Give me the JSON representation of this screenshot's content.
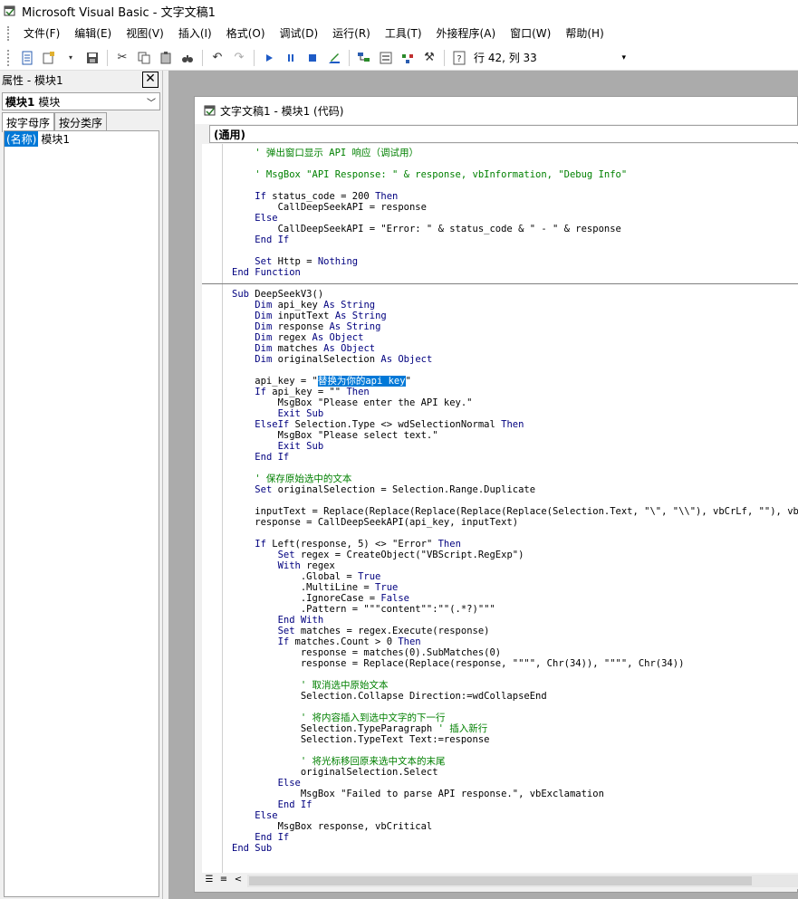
{
  "app": {
    "title": "Microsoft Visual Basic - 文字文稿1"
  },
  "menu": [
    "文件(F)",
    "编辑(E)",
    "视图(V)",
    "插入(I)",
    "格式(O)",
    "调试(D)",
    "运行(R)",
    "工具(T)",
    "外接程序(A)",
    "窗口(W)",
    "帮助(H)"
  ],
  "toolbar": {
    "status": "行 42, 列 33"
  },
  "properties": {
    "title": "属性 - 模块1",
    "object_name": "模块1",
    "object_type": "模块",
    "tabs": [
      "按字母序",
      "按分类序"
    ],
    "rows": [
      {
        "name": "(名称)",
        "value": "模块1"
      }
    ]
  },
  "code_window": {
    "title": "文字文稿1 - 模块1 (代码)",
    "object_combo": "(通用)",
    "selected_text": "替换为你的api key"
  },
  "code_lines": [
    {
      "t": "    ' 弹出窗口显示 API 响应（调试用）",
      "c": "cm"
    },
    {
      "t": "",
      "c": ""
    },
    {
      "t": "    ' MsgBox \"API Response: \" & response, vbInformation, \"Debug Info\"",
      "c": "cm"
    },
    {
      "t": "",
      "c": ""
    },
    {
      "t": "    If status_code = 200 Then",
      "c": ""
    },
    {
      "t": "        CallDeepSeekAPI = response",
      "c": ""
    },
    {
      "t": "    Else",
      "c": ""
    },
    {
      "t": "        CallDeepSeekAPI = \"Error: \" & status_code & \" - \" & response",
      "c": ""
    },
    {
      "t": "    End If",
      "c": ""
    },
    {
      "t": "",
      "c": ""
    },
    {
      "t": "    Set Http = Nothing",
      "c": ""
    },
    {
      "t": "End Function",
      "c": ""
    },
    {
      "t": "",
      "c": "sep"
    },
    {
      "t": "Sub DeepSeekV3()",
      "c": ""
    },
    {
      "t": "    Dim api_key As String",
      "c": ""
    },
    {
      "t": "    Dim inputText As String",
      "c": ""
    },
    {
      "t": "    Dim response As String",
      "c": ""
    },
    {
      "t": "    Dim regex As Object",
      "c": ""
    },
    {
      "t": "    Dim matches As Object",
      "c": ""
    },
    {
      "t": "    Dim originalSelection As Object",
      "c": ""
    },
    {
      "t": "",
      "c": ""
    },
    {
      "t": "    api_key = \"",
      "c": "apikey"
    },
    {
      "t": "    If api_key = \"\" Then",
      "c": ""
    },
    {
      "t": "        MsgBox \"Please enter the API key.\"",
      "c": ""
    },
    {
      "t": "        Exit Sub",
      "c": ""
    },
    {
      "t": "    ElseIf Selection.Type <> wdSelectionNormal Then",
      "c": ""
    },
    {
      "t": "        MsgBox \"Please select text.\"",
      "c": ""
    },
    {
      "t": "        Exit Sub",
      "c": ""
    },
    {
      "t": "    End If",
      "c": ""
    },
    {
      "t": "",
      "c": ""
    },
    {
      "t": "    ' 保存原始选中的文本",
      "c": "cm"
    },
    {
      "t": "    Set originalSelection = Selection.Range.Duplicate",
      "c": ""
    },
    {
      "t": "",
      "c": ""
    },
    {
      "t": "    inputText = Replace(Replace(Replace(Replace(Replace(Selection.Text, \"\\\", \"\\\\\"), vbCrLf, \"\"), vbCr, \"",
      "c": ""
    },
    {
      "t": "    response = CallDeepSeekAPI(api_key, inputText)",
      "c": ""
    },
    {
      "t": "",
      "c": ""
    },
    {
      "t": "    If Left(response, 5) <> \"Error\" Then",
      "c": ""
    },
    {
      "t": "        Set regex = CreateObject(\"VBScript.RegExp\")",
      "c": ""
    },
    {
      "t": "        With regex",
      "c": ""
    },
    {
      "t": "            .Global = True",
      "c": ""
    },
    {
      "t": "            .MultiLine = True",
      "c": ""
    },
    {
      "t": "            .IgnoreCase = False",
      "c": ""
    },
    {
      "t": "            .Pattern = \"\"\"content\"\":\"\"(.*?)\"\"\"",
      "c": ""
    },
    {
      "t": "        End With",
      "c": ""
    },
    {
      "t": "        Set matches = regex.Execute(response)",
      "c": ""
    },
    {
      "t": "        If matches.Count > 0 Then",
      "c": ""
    },
    {
      "t": "            response = matches(0).SubMatches(0)",
      "c": ""
    },
    {
      "t": "            response = Replace(Replace(response, \"\"\"\", Chr(34)), \"\"\"\", Chr(34))",
      "c": ""
    },
    {
      "t": "",
      "c": ""
    },
    {
      "t": "            ' 取消选中原始文本",
      "c": "cm"
    },
    {
      "t": "            Selection.Collapse Direction:=wdCollapseEnd",
      "c": ""
    },
    {
      "t": "",
      "c": ""
    },
    {
      "t": "            ' 将内容插入到选中文字的下一行",
      "c": "cm"
    },
    {
      "t": "            Selection.TypeParagraph ' 插入新行",
      "c": "mixed"
    },
    {
      "t": "            Selection.TypeText Text:=response",
      "c": ""
    },
    {
      "t": "",
      "c": ""
    },
    {
      "t": "            ' 将光标移回原来选中文本的末尾",
      "c": "cm"
    },
    {
      "t": "            originalSelection.Select",
      "c": ""
    },
    {
      "t": "        Else",
      "c": ""
    },
    {
      "t": "            MsgBox \"Failed to parse API response.\", vbExclamation",
      "c": ""
    },
    {
      "t": "        End If",
      "c": ""
    },
    {
      "t": "    Else",
      "c": ""
    },
    {
      "t": "        MsgBox response, vbCritical",
      "c": ""
    },
    {
      "t": "    End If",
      "c": ""
    },
    {
      "t": "End Sub",
      "c": ""
    }
  ],
  "colors": {
    "keyword": "#00007f",
    "comment": "#008000",
    "selection": "#0078d7"
  }
}
